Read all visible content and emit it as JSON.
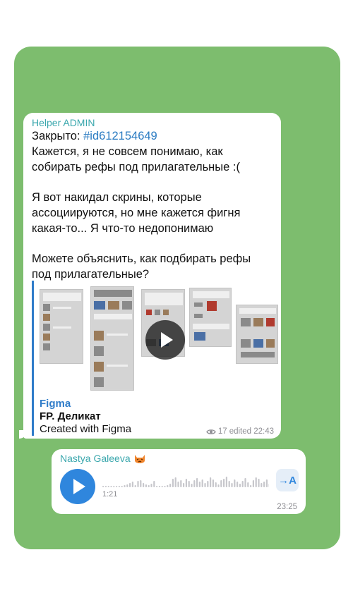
{
  "messages": [
    {
      "sender": "Helper ADMIN",
      "lines": {
        "closed_label": "Закрыто: ",
        "hashtag": "#id612154649",
        "p1": "Кажется, я не совсем понимаю, как собирать рефы под прилагательные :(",
        "p2": "Я вот накидал скрины, которые ассоциируются, но мне кажется фигня какая-то... Я что-то недопонимаю",
        "p3": "Можете объяснить, как подбирать рефы под прилагательные?"
      },
      "link_preview": {
        "site_name": "Figma",
        "title": "FP. Деликат",
        "description": "Created with Figma",
        "image_icon": "play-icon"
      },
      "meta": {
        "views_icon": "eye-icon",
        "views": "17",
        "edited_time": "edited 22:43"
      }
    },
    {
      "sender": "Nastya Galeeva",
      "sender_emoji_icon": "cat-emoji-icon",
      "voice": {
        "duration": "1:21",
        "transcribe_label": "→A",
        "time": "23:25"
      }
    }
  ],
  "colors": {
    "chat_background": "#7dbd6e",
    "sender_name": "#3aa7ad",
    "link": "#2f7cc9",
    "voice_play": "#2f86dd"
  }
}
